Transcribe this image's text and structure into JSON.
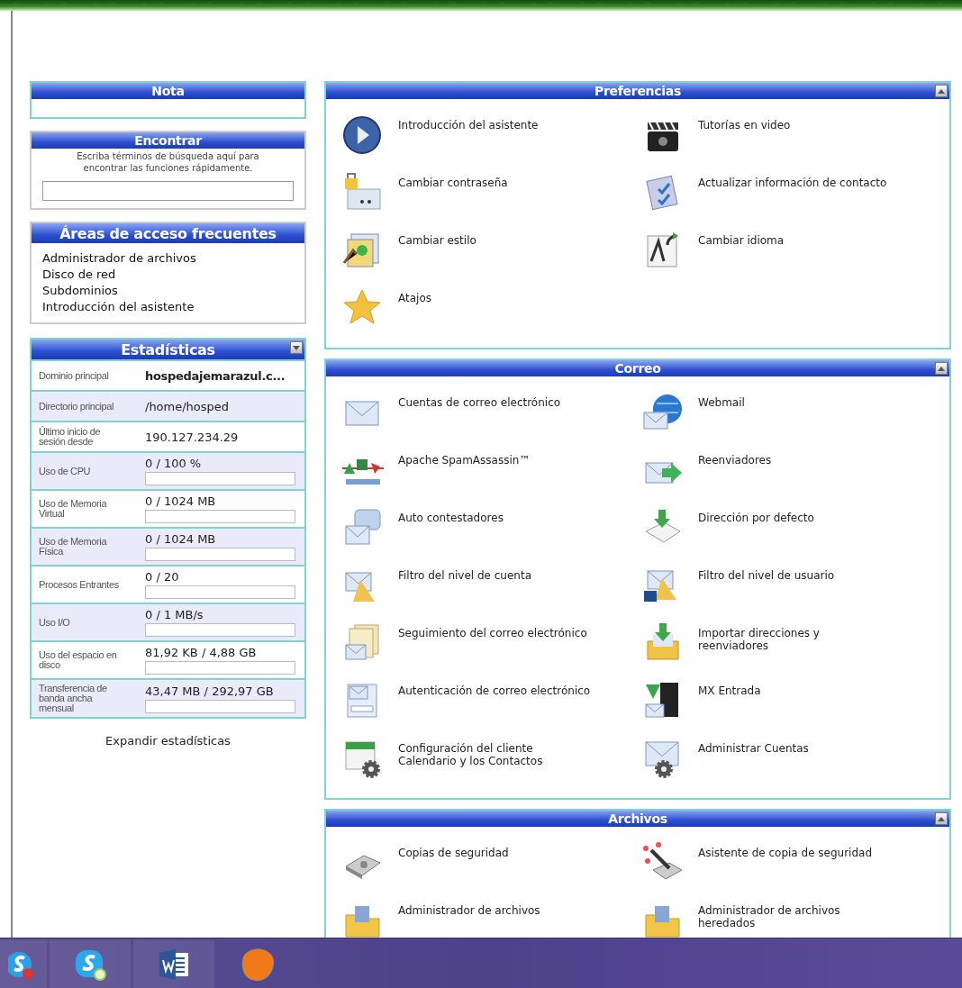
{
  "left": {
    "note": {
      "title": "Nota"
    },
    "find": {
      "title": "Encontrar",
      "hint": "Escriba términos de búsqueda aquí para encontrar las funciones rápidamente."
    },
    "frequent": {
      "title": "Áreas de acceso frecuentes",
      "links": [
        "Administrador de archivos",
        "Disco de red",
        "Subdominios",
        "Introducción del asistente"
      ]
    },
    "stats": {
      "title": "Estadísticas",
      "expanded": false,
      "rows": [
        {
          "kind": "text",
          "label": "Dominio principal",
          "value": "hospedajemarazul.c...",
          "bold": true
        },
        {
          "kind": "text",
          "label": "Directorio principal",
          "value": "/home/hosped",
          "bold": false
        },
        {
          "kind": "text",
          "label": "Último inicio de sesión desde",
          "value": "190.127.234.29",
          "bold": false
        },
        {
          "kind": "meter",
          "label": "Uso de CPU",
          "value": "0 / 100 %",
          "level": 0
        },
        {
          "kind": "meter",
          "label": "Uso de Memoria Virtual",
          "value": "0 / 1024 MB",
          "level": 0
        },
        {
          "kind": "meter",
          "label": "Uso de Memoria Física",
          "value": "0 / 1024 MB",
          "level": 0
        },
        {
          "kind": "meter",
          "label": "Procesos Entrantes",
          "value": "0 / 20",
          "level": 0
        },
        {
          "kind": "meter",
          "label": "Uso I/O",
          "value": "0 / 1 MB/s",
          "level": 0
        },
        {
          "kind": "meter",
          "label": "Uso del espacio en disco",
          "value": "81,92 KB / 4,88 GB",
          "level": 0
        },
        {
          "kind": "meter",
          "label": "Transferencia de banda ancha mensual",
          "value": "43,47 MB / 292,97 GB",
          "level": 0
        }
      ],
      "expand_link": "Expandir estadísticas"
    }
  },
  "sections": [
    {
      "title": "Preferencias",
      "expanded": true,
      "items": [
        "Introducción del asistente",
        "Tutorías en video",
        "Cambiar contraseña",
        "Actualizar información de contacto",
        "Cambiar estilo",
        "Cambiar idioma",
        "Atajos"
      ]
    },
    {
      "title": "Correo",
      "expanded": true,
      "items": [
        "Cuentas de correo electrónico",
        "Webmail",
        "Apache SpamAssassin™",
        "Reenviadores",
        "Auto contestadores",
        "Dirección por defecto",
        "Filtro del nivel de cuenta",
        "Filtro del nivel de usuario",
        "Seguimiento del correo electrónico",
        "Importar direcciones y reenviadores",
        "Autenticación de correo electrónico",
        "MX Entrada",
        "Configuración del cliente Calendario y los Contactos",
        "Administrar Cuentas"
      ]
    },
    {
      "title": "Archivos",
      "expanded": true,
      "items": [
        "Copias de seguridad",
        "Asistente de copia de seguridad",
        "Administrador de archivos",
        "Administrador de archivos heredados"
      ]
    }
  ]
}
